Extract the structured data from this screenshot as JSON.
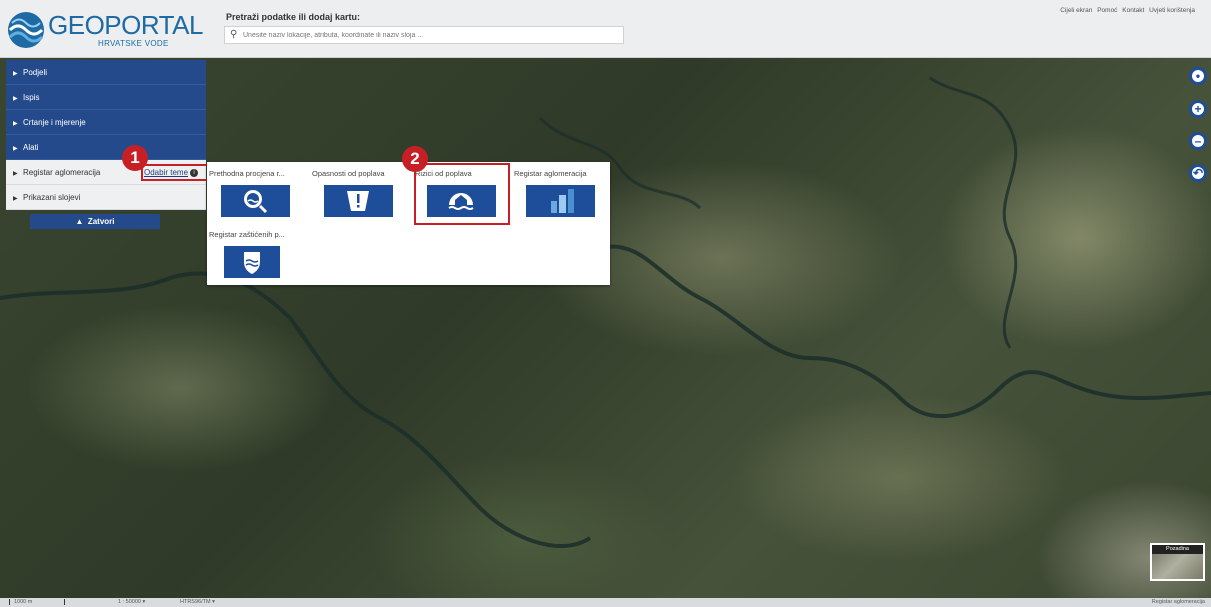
{
  "header": {
    "logo_text": "GEOPORTAL",
    "logo_subtext": "HRVATSKE VODE",
    "search_title": "Pretraži podatke ili dodaj kartu:",
    "search_placeholder": "Unesite naziv lokacije, atributa, koordinate ili naziv sloja ...",
    "top_links": [
      "Cijeli ekran",
      "Pomoć",
      "Kontakt",
      "Uvjeti korištenja"
    ]
  },
  "sidebar": {
    "items": [
      {
        "label": "Podjeli"
      },
      {
        "label": "Ispis"
      },
      {
        "label": "Crtanje i mjerenje"
      },
      {
        "label": "Alati"
      },
      {
        "label": "Registar aglomeracija"
      },
      {
        "label": "Prikazani slojevi"
      }
    ],
    "odabir_label": "Odabir teme",
    "close_label": "Zatvori"
  },
  "themes": [
    {
      "label": "Prethodna procjena r...",
      "icon": "magnifier-flood-icon"
    },
    {
      "label": "Opasnosti od poplava",
      "icon": "warning-flood-icon"
    },
    {
      "label": "Rizici od poplava",
      "icon": "house-flood-icon"
    },
    {
      "label": "Registar aglomeracija",
      "icon": "buildings-icon"
    },
    {
      "label": "Registar zaštićenih p...",
      "icon": "shield-water-icon"
    }
  ],
  "annotations": {
    "badge_1": "1",
    "badge_2": "2"
  },
  "bottom": {
    "scale": "1000 m",
    "ratio": "1 : 50000",
    "projection": "HTRS96/TM",
    "right_text": "Registar aglomeracija"
  },
  "minimap": {
    "label": "Pozadina"
  },
  "colors": {
    "primary": "#244a8c",
    "highlight": "#c62026",
    "icon_bg": "#1e4d99"
  }
}
